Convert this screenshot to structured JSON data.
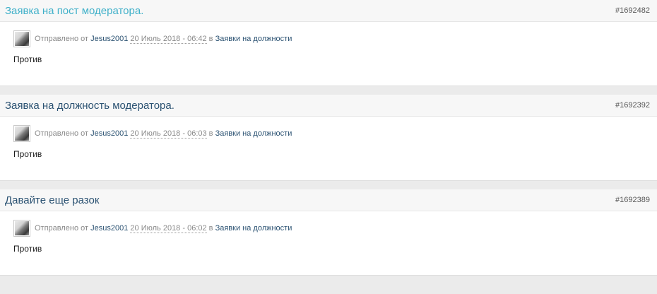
{
  "posts": [
    {
      "title": "Заявка на пост модератора.",
      "id": "#1692482",
      "sent_prefix": "Отправлено от",
      "author": "Jesus2001",
      "date": "20 Июль 2018 - 06:42",
      "in_word": "в",
      "forum": "Заявки на должности",
      "text": "Против"
    },
    {
      "title": "Заявка на должность модератора.",
      "id": "#1692392",
      "sent_prefix": "Отправлено от",
      "author": "Jesus2001",
      "date": "20 Июль 2018 - 06:03",
      "in_word": "в",
      "forum": "Заявки на должности",
      "text": "Против"
    },
    {
      "title": "Давайте еще разок",
      "id": "#1692389",
      "sent_prefix": "Отправлено от",
      "author": "Jesus2001",
      "date": "20 Июль 2018 - 06:02",
      "in_word": "в",
      "forum": "Заявки на должности",
      "text": "Против"
    }
  ]
}
